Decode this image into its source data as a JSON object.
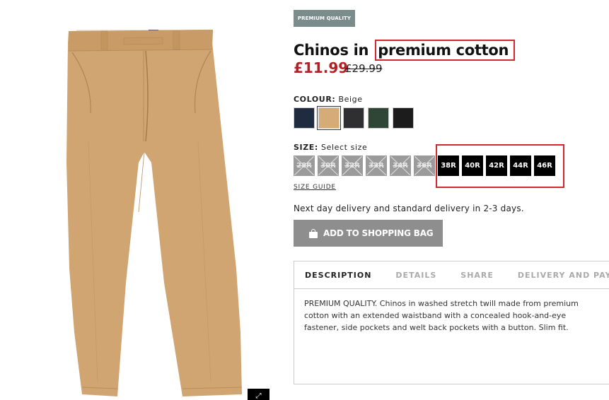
{
  "product": {
    "badge": "PREMIUM QUALITY",
    "title_prefix": "Chinos in",
    "title_highlight": "premium cotton",
    "price": "£11.99",
    "old_price": "£29.99"
  },
  "colour": {
    "label": "COLOUR:",
    "selected": "Beige",
    "swatches": [
      {
        "name": "navy",
        "color": "#1f2b3e"
      },
      {
        "name": "beige",
        "color": "#d5ac78",
        "selected": true
      },
      {
        "name": "dark-grey",
        "color": "#2f2f31"
      },
      {
        "name": "dark-green",
        "color": "#2f4535"
      },
      {
        "name": "black",
        "color": "#1c1c1c"
      }
    ]
  },
  "size": {
    "label": "SIZE:",
    "placeholder": "Select size",
    "options": [
      {
        "label": "28R",
        "available": false
      },
      {
        "label": "30R",
        "available": false
      },
      {
        "label": "32R",
        "available": false
      },
      {
        "label": "33R",
        "available": false
      },
      {
        "label": "34R",
        "available": false
      },
      {
        "label": "36R",
        "available": false
      },
      {
        "label": "38R",
        "available": true
      },
      {
        "label": "40R",
        "available": true
      },
      {
        "label": "42R",
        "available": true
      },
      {
        "label": "44R",
        "available": true
      },
      {
        "label": "46R",
        "available": true
      }
    ],
    "guide": "SIZE GUIDE"
  },
  "delivery_text": "Next day delivery and standard delivery in 2-3 days.",
  "add_to_bag": "ADD TO SHOPPING BAG",
  "tabs": [
    {
      "label": "DESCRIPTION",
      "active": true
    },
    {
      "label": "DETAILS"
    },
    {
      "label": "SHARE"
    },
    {
      "label": "DELIVERY AND PAYMENT"
    }
  ],
  "description": "PREMIUM QUALITY. Chinos in washed stretch twill made from premium cotton with an extended waistband with a concealed hook-and-eye fastener, side pockets and welt back pockets with a button. Slim fit.",
  "expand_icon": "expand-icon",
  "colors": {
    "sale_red": "#b52025",
    "highlight_red": "#d62630",
    "pants": "#d1a571"
  }
}
